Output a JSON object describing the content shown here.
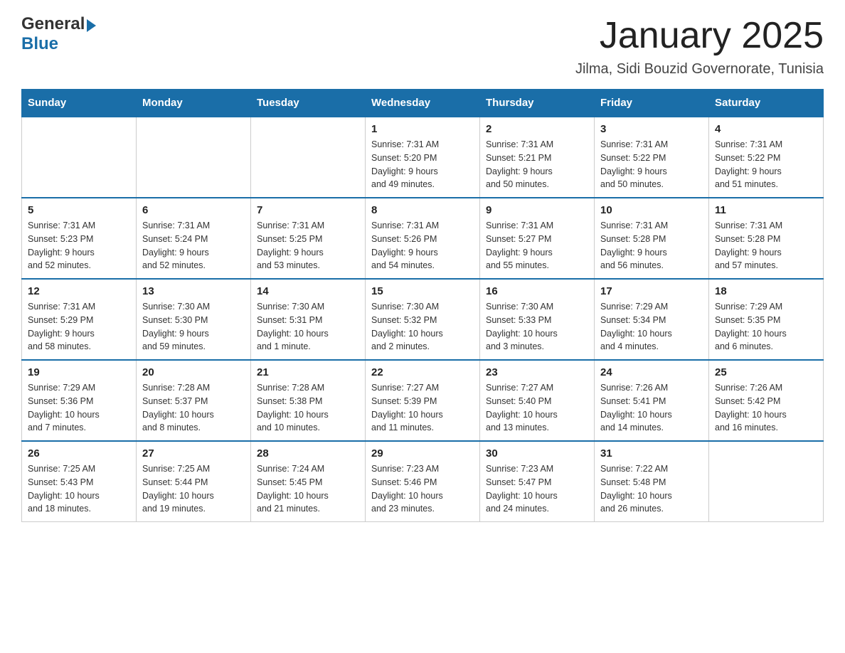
{
  "logo": {
    "general": "General",
    "blue": "Blue",
    "arrow": "▶"
  },
  "header": {
    "title": "January 2025",
    "subtitle": "Jilma, Sidi Bouzid Governorate, Tunisia"
  },
  "weekdays": [
    "Sunday",
    "Monday",
    "Tuesday",
    "Wednesday",
    "Thursday",
    "Friday",
    "Saturday"
  ],
  "weeks": [
    [
      {
        "day": "",
        "info": ""
      },
      {
        "day": "",
        "info": ""
      },
      {
        "day": "",
        "info": ""
      },
      {
        "day": "1",
        "info": "Sunrise: 7:31 AM\nSunset: 5:20 PM\nDaylight: 9 hours\nand 49 minutes."
      },
      {
        "day": "2",
        "info": "Sunrise: 7:31 AM\nSunset: 5:21 PM\nDaylight: 9 hours\nand 50 minutes."
      },
      {
        "day": "3",
        "info": "Sunrise: 7:31 AM\nSunset: 5:22 PM\nDaylight: 9 hours\nand 50 minutes."
      },
      {
        "day": "4",
        "info": "Sunrise: 7:31 AM\nSunset: 5:22 PM\nDaylight: 9 hours\nand 51 minutes."
      }
    ],
    [
      {
        "day": "5",
        "info": "Sunrise: 7:31 AM\nSunset: 5:23 PM\nDaylight: 9 hours\nand 52 minutes."
      },
      {
        "day": "6",
        "info": "Sunrise: 7:31 AM\nSunset: 5:24 PM\nDaylight: 9 hours\nand 52 minutes."
      },
      {
        "day": "7",
        "info": "Sunrise: 7:31 AM\nSunset: 5:25 PM\nDaylight: 9 hours\nand 53 minutes."
      },
      {
        "day": "8",
        "info": "Sunrise: 7:31 AM\nSunset: 5:26 PM\nDaylight: 9 hours\nand 54 minutes."
      },
      {
        "day": "9",
        "info": "Sunrise: 7:31 AM\nSunset: 5:27 PM\nDaylight: 9 hours\nand 55 minutes."
      },
      {
        "day": "10",
        "info": "Sunrise: 7:31 AM\nSunset: 5:28 PM\nDaylight: 9 hours\nand 56 minutes."
      },
      {
        "day": "11",
        "info": "Sunrise: 7:31 AM\nSunset: 5:28 PM\nDaylight: 9 hours\nand 57 minutes."
      }
    ],
    [
      {
        "day": "12",
        "info": "Sunrise: 7:31 AM\nSunset: 5:29 PM\nDaylight: 9 hours\nand 58 minutes."
      },
      {
        "day": "13",
        "info": "Sunrise: 7:30 AM\nSunset: 5:30 PM\nDaylight: 9 hours\nand 59 minutes."
      },
      {
        "day": "14",
        "info": "Sunrise: 7:30 AM\nSunset: 5:31 PM\nDaylight: 10 hours\nand 1 minute."
      },
      {
        "day": "15",
        "info": "Sunrise: 7:30 AM\nSunset: 5:32 PM\nDaylight: 10 hours\nand 2 minutes."
      },
      {
        "day": "16",
        "info": "Sunrise: 7:30 AM\nSunset: 5:33 PM\nDaylight: 10 hours\nand 3 minutes."
      },
      {
        "day": "17",
        "info": "Sunrise: 7:29 AM\nSunset: 5:34 PM\nDaylight: 10 hours\nand 4 minutes."
      },
      {
        "day": "18",
        "info": "Sunrise: 7:29 AM\nSunset: 5:35 PM\nDaylight: 10 hours\nand 6 minutes."
      }
    ],
    [
      {
        "day": "19",
        "info": "Sunrise: 7:29 AM\nSunset: 5:36 PM\nDaylight: 10 hours\nand 7 minutes."
      },
      {
        "day": "20",
        "info": "Sunrise: 7:28 AM\nSunset: 5:37 PM\nDaylight: 10 hours\nand 8 minutes."
      },
      {
        "day": "21",
        "info": "Sunrise: 7:28 AM\nSunset: 5:38 PM\nDaylight: 10 hours\nand 10 minutes."
      },
      {
        "day": "22",
        "info": "Sunrise: 7:27 AM\nSunset: 5:39 PM\nDaylight: 10 hours\nand 11 minutes."
      },
      {
        "day": "23",
        "info": "Sunrise: 7:27 AM\nSunset: 5:40 PM\nDaylight: 10 hours\nand 13 minutes."
      },
      {
        "day": "24",
        "info": "Sunrise: 7:26 AM\nSunset: 5:41 PM\nDaylight: 10 hours\nand 14 minutes."
      },
      {
        "day": "25",
        "info": "Sunrise: 7:26 AM\nSunset: 5:42 PM\nDaylight: 10 hours\nand 16 minutes."
      }
    ],
    [
      {
        "day": "26",
        "info": "Sunrise: 7:25 AM\nSunset: 5:43 PM\nDaylight: 10 hours\nand 18 minutes."
      },
      {
        "day": "27",
        "info": "Sunrise: 7:25 AM\nSunset: 5:44 PM\nDaylight: 10 hours\nand 19 minutes."
      },
      {
        "day": "28",
        "info": "Sunrise: 7:24 AM\nSunset: 5:45 PM\nDaylight: 10 hours\nand 21 minutes."
      },
      {
        "day": "29",
        "info": "Sunrise: 7:23 AM\nSunset: 5:46 PM\nDaylight: 10 hours\nand 23 minutes."
      },
      {
        "day": "30",
        "info": "Sunrise: 7:23 AM\nSunset: 5:47 PM\nDaylight: 10 hours\nand 24 minutes."
      },
      {
        "day": "31",
        "info": "Sunrise: 7:22 AM\nSunset: 5:48 PM\nDaylight: 10 hours\nand 26 minutes."
      },
      {
        "day": "",
        "info": ""
      }
    ]
  ]
}
